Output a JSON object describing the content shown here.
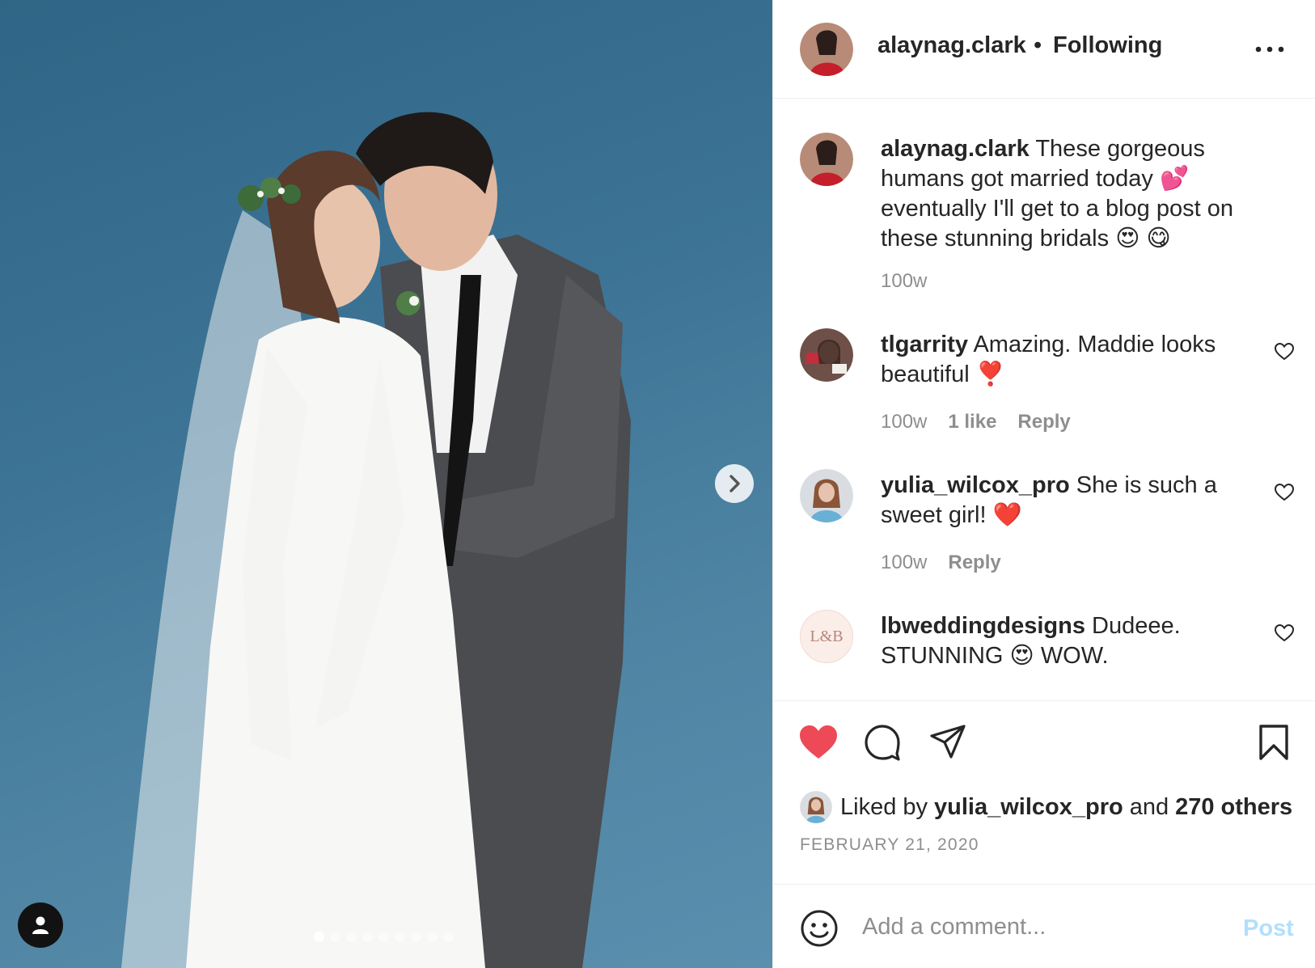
{
  "post": {
    "author": "alaynag.clark",
    "separator": "•",
    "follow_status": "Following",
    "more_icon": "more-horizontal-icon"
  },
  "caption": {
    "username": "alaynag.clark",
    "text_1": "These gorgeous humans got married today",
    "emoji_1": "💕",
    "text_2": "eventually I'll get to a blog post on these stunning bridals",
    "emoji_2": "😍 😋",
    "time": "100w"
  },
  "comments": [
    {
      "username": "tlgarrity",
      "text": "Amazing. Maddie looks beautiful",
      "emoji": "❣️",
      "time": "100w",
      "likes": "1 like",
      "reply": "Reply"
    },
    {
      "username": "yulia_wilcox_pro",
      "text": "She is such a sweet girl!",
      "emoji": "❤️",
      "time": "100w",
      "reply": "Reply"
    },
    {
      "username": "lbweddingdesigns",
      "text": "Dudeee. STUNNING",
      "emoji": "😍",
      "text_after": "WOW.",
      "avatar_text": "L&B"
    }
  ],
  "likes": {
    "prefix": "Liked by",
    "user": "yulia_wilcox_pro",
    "middle": "and",
    "others": "270 others"
  },
  "date": "FEBRUARY 21, 2020",
  "comment_box": {
    "placeholder": "Add a comment...",
    "post_label": "Post"
  },
  "carousel": {
    "count": 9,
    "active_index": 0
  },
  "colors": {
    "like_red": "#ed4956",
    "post_blue": "#b2dffc",
    "muted": "#8e8e8e",
    "backdrop": "#3d7496"
  }
}
